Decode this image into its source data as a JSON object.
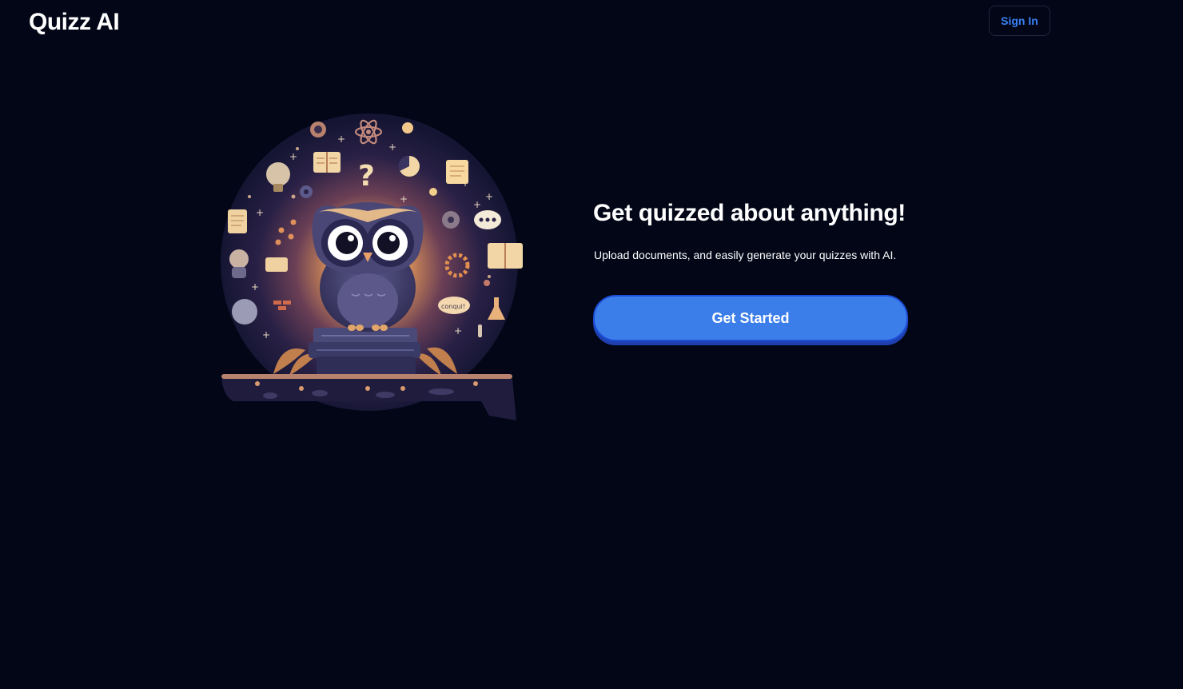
{
  "header": {
    "logo": "Quizz AI",
    "signin_label": "Sign In"
  },
  "hero": {
    "illustration": "owl-on-books-icon",
    "bubble_text": "conqui!",
    "headline": "Get quizzed about anything!",
    "subtext": "Upload documents, and easily generate your quizzes with AI.",
    "cta_label": "Get Started"
  },
  "colors": {
    "background": "#020617",
    "accent": "#3b7de9",
    "signin_text": "#3b82f6"
  }
}
